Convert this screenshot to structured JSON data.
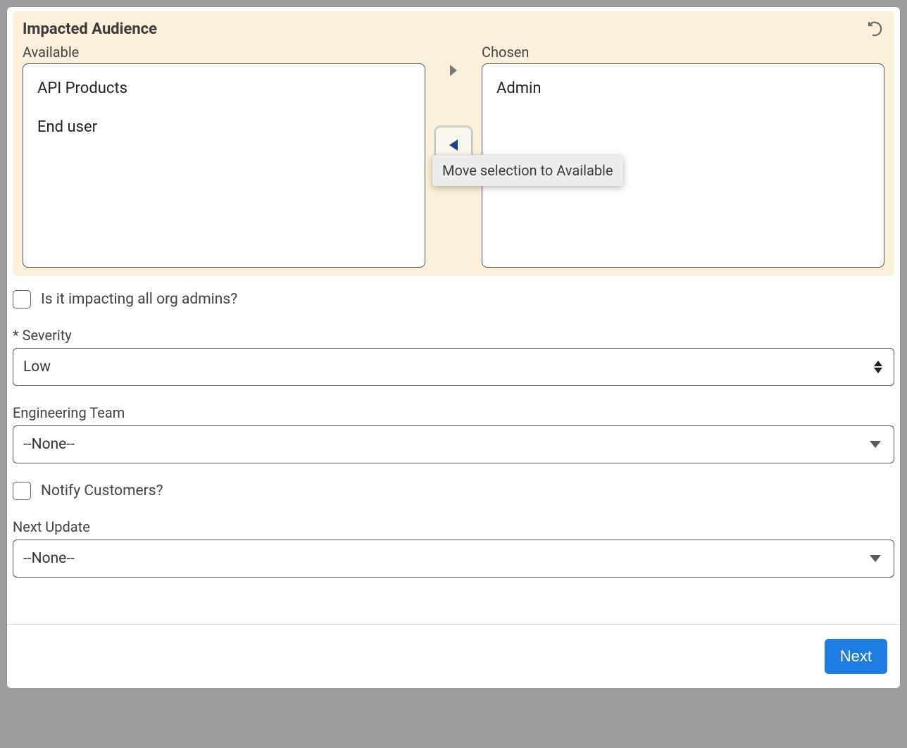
{
  "audience": {
    "title": "Impacted Audience",
    "available_label": "Available",
    "chosen_label": "Chosen",
    "available_items": [
      "API Products",
      "End user"
    ],
    "chosen_items": [
      "Admin"
    ],
    "tooltip_move_left": "Move selection to Available"
  },
  "form": {
    "impacting_all_label": "Is it impacting all org admins?",
    "severity_label": "* Severity",
    "severity_value": "Low",
    "engineering_team_label": "Engineering Team",
    "engineering_team_value": "--None--",
    "notify_customers_label": "Notify Customers?",
    "next_update_label": "Next Update",
    "next_update_value": "--None--"
  },
  "footer": {
    "next_label": "Next"
  }
}
